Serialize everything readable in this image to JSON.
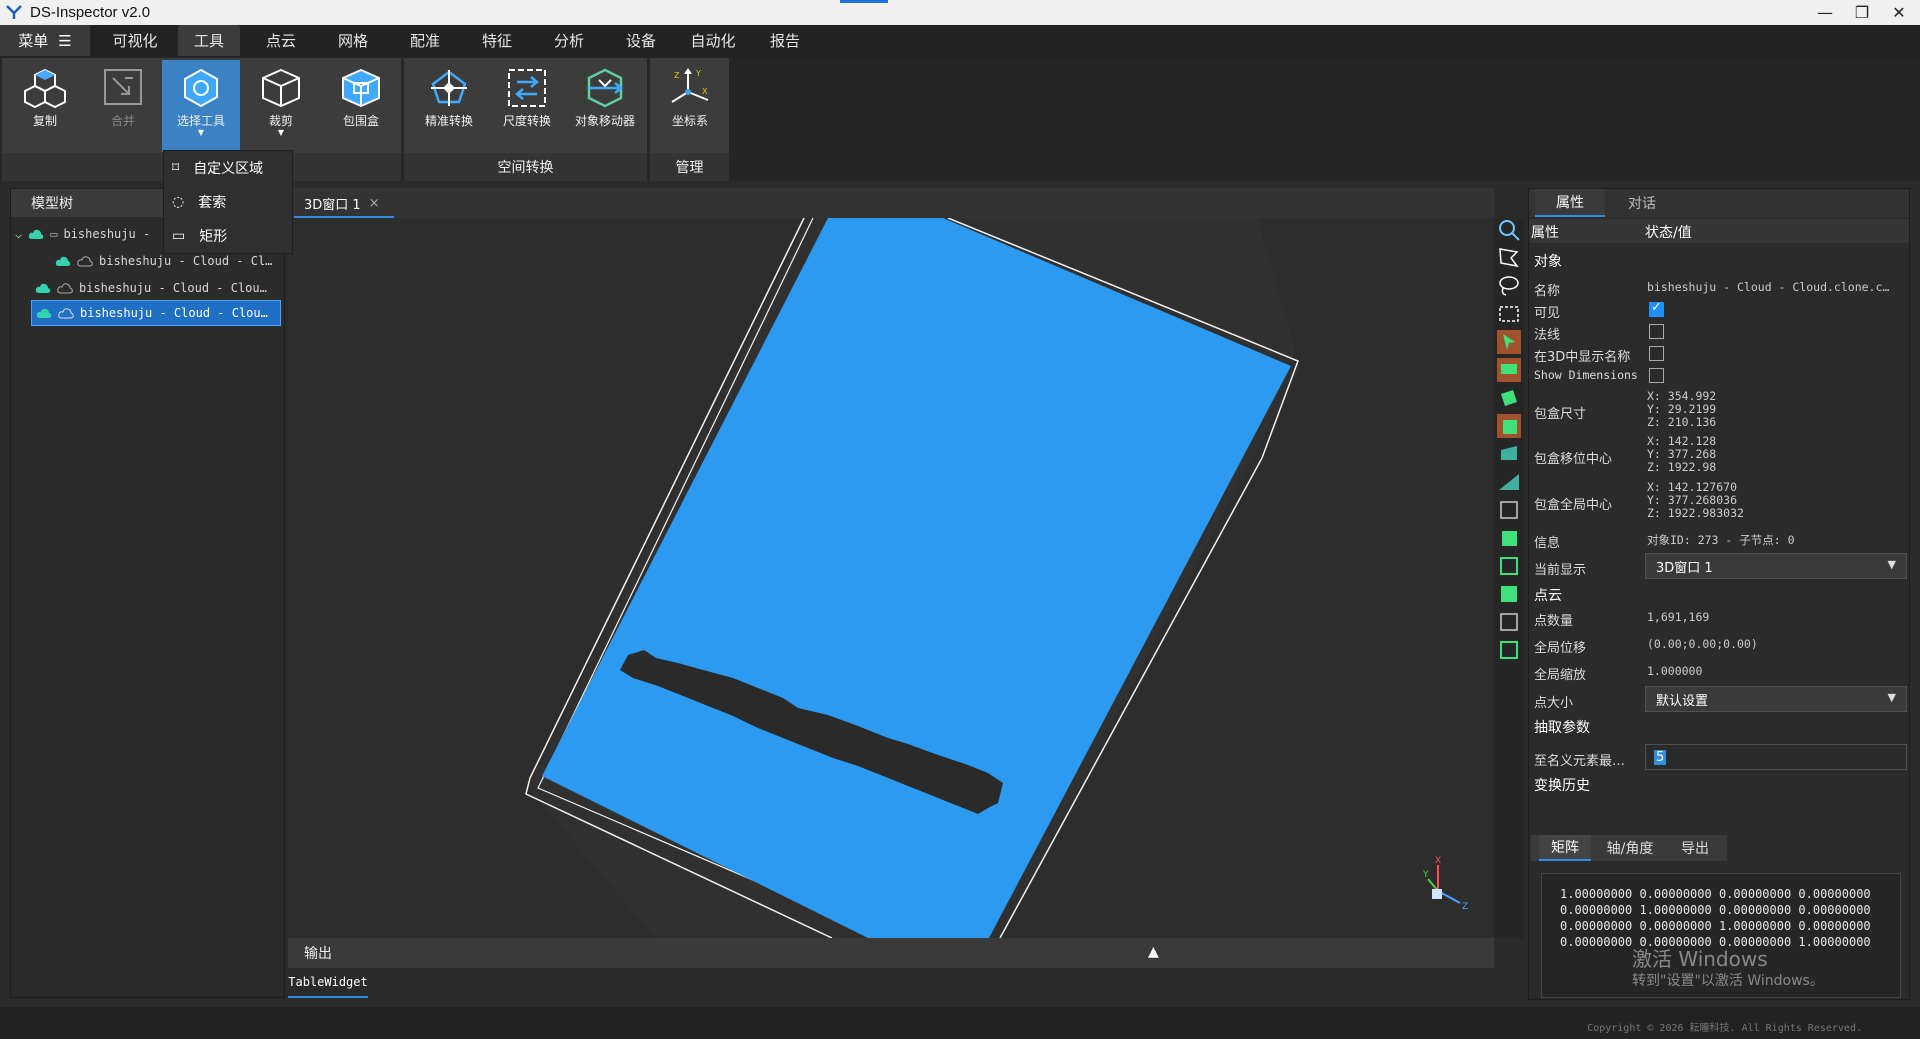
{
  "app": {
    "title": "DS-Inspector v2.0"
  },
  "window_controls": {
    "minimize": "—",
    "restore": "❐",
    "close": "✕"
  },
  "menubar": {
    "main_label": "菜单",
    "items": [
      "可视化",
      "工具",
      "点云",
      "网格",
      "配准",
      "特征",
      "分析",
      "设备",
      "自动化",
      "报告"
    ],
    "active": "工具"
  },
  "ribbon": {
    "buttons": [
      {
        "label": "复制",
        "icon": "copy-cubes-icon"
      },
      {
        "label": "合并",
        "icon": "merge-icon",
        "disabled": true
      },
      {
        "label": "选择工具",
        "icon": "select-tool-icon",
        "active": true
      },
      {
        "label": "裁剪",
        "icon": "crop-cube-icon"
      },
      {
        "label": "包围盒",
        "icon": "bounding-box-icon"
      },
      {
        "label": "精准转换",
        "icon": "precise-transform-icon"
      },
      {
        "label": "尺度转换",
        "icon": "scale-transform-icon"
      },
      {
        "label": "对象移动器",
        "icon": "object-mover-icon"
      },
      {
        "label": "坐标系",
        "icon": "coordinate-system-icon"
      }
    ],
    "groups": [
      "空间转换",
      "管理"
    ]
  },
  "dropdown": {
    "items": [
      "自定义区域",
      "套索",
      "矩形"
    ]
  },
  "model_tree": {
    "header": "模型树",
    "rows": [
      {
        "text": "bisheshuju -"
      },
      {
        "text": "bisheshuju - Cloud - Cl…"
      },
      {
        "text": "bisheshuju - Cloud - Clou…"
      },
      {
        "text": "bisheshuju - Cloud - Clou…"
      }
    ]
  },
  "viewport": {
    "tab_label": "3D窗口 1",
    "tab_close": "×",
    "axis_labels": {
      "x": "X",
      "y": "Y",
      "z": "Z"
    }
  },
  "output": {
    "label": "输出",
    "tab": "TableWidget",
    "toggle": "▲"
  },
  "properties": {
    "tabs": [
      "属性",
      "对话"
    ],
    "head_key": "属性",
    "head_val": "状态/值",
    "section_object": "对象",
    "name_key": "名称",
    "name_val": "bisheshuju - Cloud - Cloud.clone.c…",
    "visible_key": "可见",
    "visible": true,
    "normals_key": "法线",
    "normals": false,
    "show_name_key": "在3D中显示名称",
    "show_name": false,
    "show_dims_key": "Show Dimensions",
    "show_dims": false,
    "bbox_size_key": "包盒尺寸",
    "bbox_size": [
      "X: 354.992",
      "Y: 29.2199",
      "Z: 210.136"
    ],
    "bbox_shift_key": "包盒移位中心",
    "bbox_shift": [
      "X: 142.128",
      "Y: 377.268",
      "Z: 1922.98"
    ],
    "bbox_global_key": "包盒全局中心",
    "bbox_global": [
      "X: 142.127670",
      "Y: 377.268036",
      "Z: 1922.983032"
    ],
    "info_key": "信息",
    "info_val": "对象ID: 273 - 子节点: 0",
    "current_display_key": "当前显示",
    "current_display_val": "3D窗口 1",
    "section_cloud": "点云",
    "points_key": "点数量",
    "points_val": "1,691,169",
    "global_shift_key": "全局位移",
    "global_shift_val": "(0.00;0.00;0.00)",
    "global_scale_key": "全局缩放",
    "global_scale_val": "1.000000",
    "point_size_key": "点大小",
    "point_size_val": "默认设置",
    "section_sampling": "抽取参数",
    "min_elem_key": "至名义元素最…",
    "min_elem_val": "5",
    "section_history": "变换历史",
    "matrix_tabs": [
      "矩阵",
      "轴/角度",
      "导出"
    ],
    "matrix": [
      "1.00000000 0.00000000 0.00000000 0.00000000",
      "0.00000000 1.00000000 0.00000000 0.00000000",
      "0.00000000 0.00000000 1.00000000 0.00000000",
      "0.00000000 0.00000000 0.00000000 1.00000000"
    ]
  },
  "watermark": {
    "line1": "激活 Windows",
    "line2": "转到\"设置\"以激活 Windows。"
  },
  "status": {
    "copyright": "Copyright © 2026 耘瞳科技. All Rights Reserved."
  },
  "colors": {
    "accent": "#2f8de4",
    "cloud": "#2b9af0",
    "active_ribbon": "#3b82c4"
  }
}
